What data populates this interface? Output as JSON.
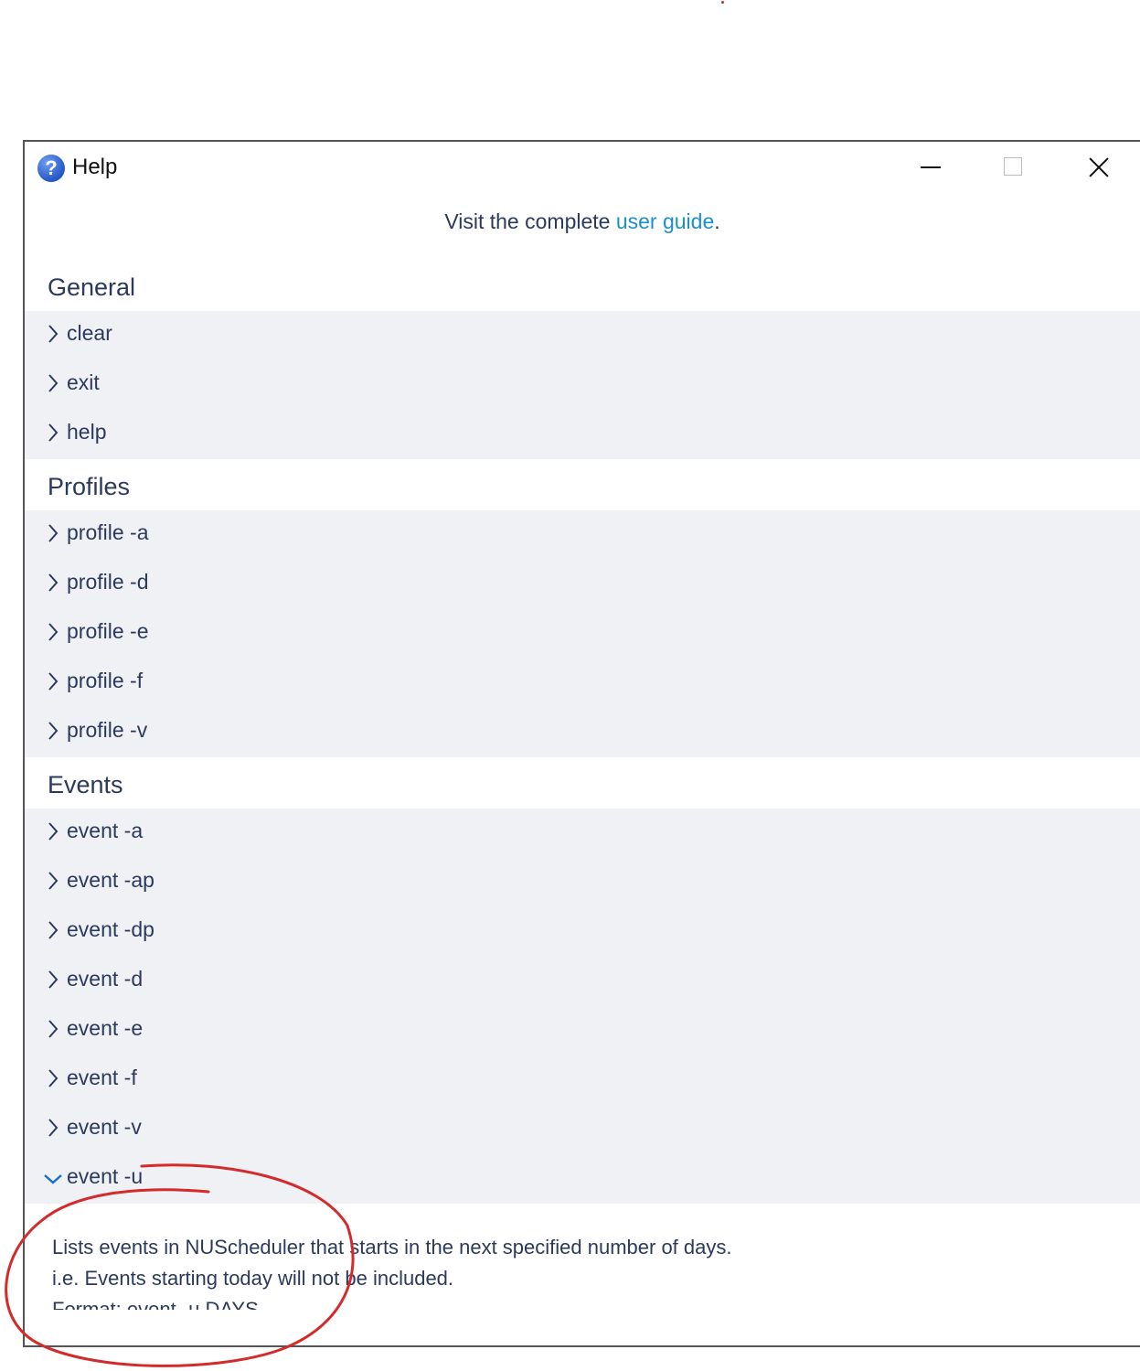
{
  "window": {
    "title": "Help",
    "icon": "help-question-icon"
  },
  "guide": {
    "prefix": "Visit the complete",
    "link_text": "user guide",
    "suffix": "."
  },
  "sections": {
    "general": {
      "title": "General",
      "items": [
        "clear",
        "exit",
        "help"
      ]
    },
    "profiles": {
      "title": "Profiles",
      "items": [
        "profile -a",
        "profile -d",
        "profile -e",
        "profile -f",
        "profile -v"
      ]
    },
    "events": {
      "title": "Events",
      "items": [
        "event -a",
        "event -ap",
        "event -dp",
        "event -d",
        "event -e",
        "event -f",
        "event -v",
        "event -u"
      ]
    }
  },
  "expanded": {
    "lines": [
      "Lists events in NUScheduler that starts in the next specified number of days.",
      "i.e. Events starting today will not be included.",
      "Format: event -u DAYS"
    ]
  },
  "colors": {
    "link": "#1a8fc9",
    "text": "#2b3a5c",
    "annotation": "#d32b2b",
    "group_bg": "#f0f1f5"
  }
}
